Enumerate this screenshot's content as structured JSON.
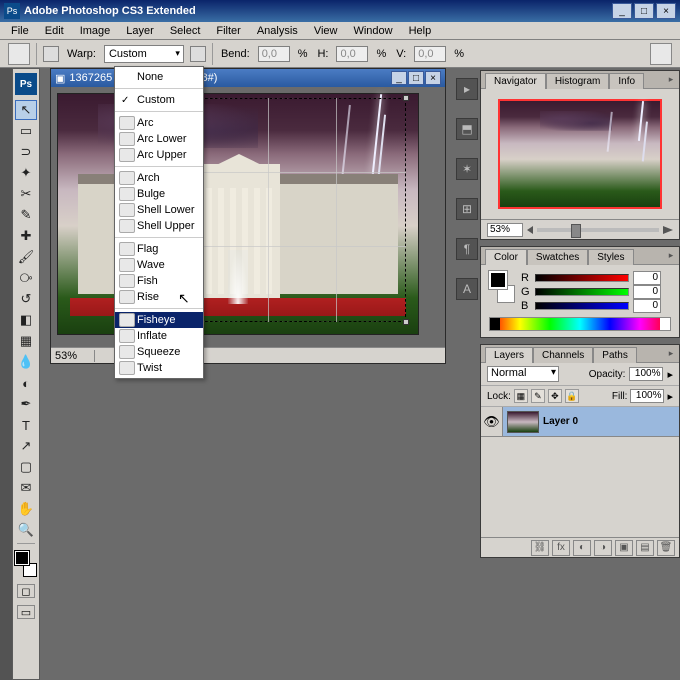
{
  "app": {
    "title": "Adobe Photoshop CS3 Extended"
  },
  "menu": [
    "File",
    "Edit",
    "Image",
    "Layer",
    "Select",
    "Filter",
    "Analysis",
    "View",
    "Window",
    "Help"
  ],
  "options": {
    "warp_label": "Warp:",
    "warp_value": "Custom",
    "bend_label": "Bend:",
    "bend_val": "0,0",
    "pct": "%",
    "h_label": "H:",
    "h_val": "0,0",
    "v_label": "V:",
    "v_val": "0,0"
  },
  "warp_menu": {
    "none": "None",
    "custom": "Custom",
    "g1": [
      "Arc",
      "Arc Lower",
      "Arc Upper"
    ],
    "g2": [
      "Arch",
      "Bulge",
      "Shell Lower",
      "Shell Upper"
    ],
    "g3": [
      "Flag",
      "Wave",
      "Fish",
      "Rise"
    ],
    "g4": [
      "Fisheye",
      "Inflate",
      "Squeeze",
      "Twist"
    ],
    "highlighted": "Fisheye"
  },
  "doc": {
    "title": "1367265             % (Layer 0, RGB/8#)",
    "zoom": "53%",
    "info": ""
  },
  "navigator": {
    "tabs": [
      "Navigator",
      "Histogram",
      "Info"
    ],
    "zoom": "53%"
  },
  "color": {
    "tabs": [
      "Color",
      "Swatches",
      "Styles"
    ],
    "r": "0",
    "g": "0",
    "b": "0",
    "lr": "R",
    "lg": "G",
    "lb": "B"
  },
  "layers": {
    "tabs": [
      "Layers",
      "Channels",
      "Paths"
    ],
    "blend": "Normal",
    "opacity_label": "Opacity:",
    "opacity": "100%",
    "lock_label": "Lock:",
    "fill_label": "Fill:",
    "fill": "100%",
    "layer0": "Layer 0"
  }
}
